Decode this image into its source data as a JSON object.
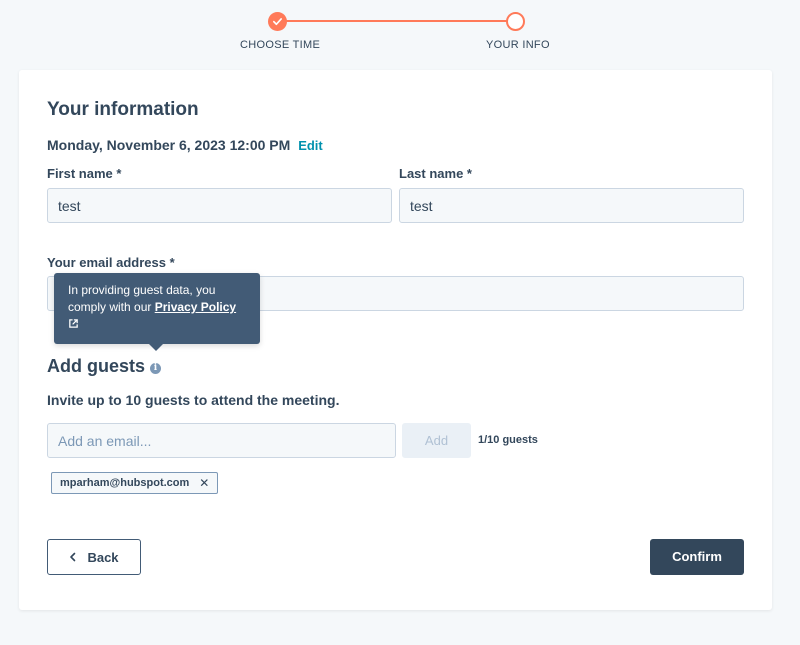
{
  "stepper": {
    "steps": [
      {
        "label": "CHOOSE TIME",
        "state": "done"
      },
      {
        "label": "YOUR INFO",
        "state": "current"
      }
    ],
    "accent_color": "#ff7a59"
  },
  "form": {
    "title": "Your information",
    "datetime": "Monday, November 6, 2023 12:00 PM",
    "edit_label": "Edit",
    "first_name": {
      "label": "First name *",
      "value": "test"
    },
    "last_name": {
      "label": "Last name *",
      "value": "test"
    },
    "email": {
      "label": "Your email address *",
      "value": ""
    }
  },
  "tooltip": {
    "text": "In providing guest data, you comply with our",
    "link_label": "Privacy Policy"
  },
  "guests": {
    "title": "Add guests",
    "info_icon": "info-icon",
    "invite_text": "Invite up to 10 guests to attend the meeting.",
    "input_placeholder": "Add an email...",
    "add_label": "Add",
    "count_label": "1/10 guests",
    "chips": [
      {
        "email": "mparham@hubspot.com"
      }
    ]
  },
  "actions": {
    "back_label": "Back",
    "confirm_label": "Confirm"
  }
}
